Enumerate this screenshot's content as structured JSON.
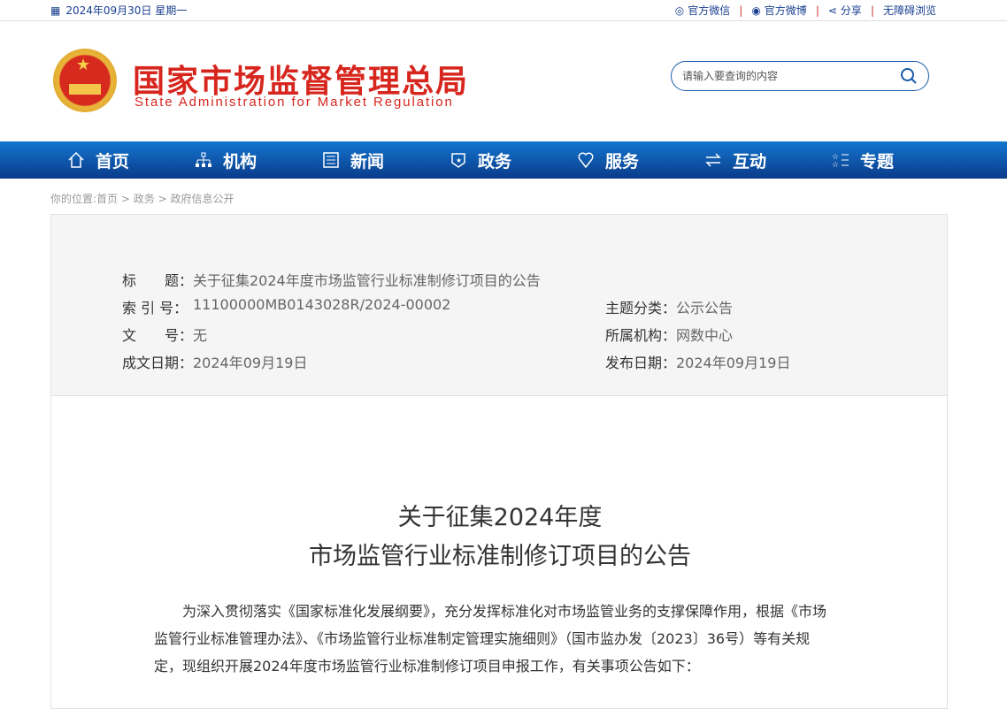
{
  "topbar": {
    "date": "2024年09月30日 星期一",
    "links": [
      "官方微信",
      "官方微博",
      "分享",
      "无障碍浏览"
    ]
  },
  "header": {
    "title": "国家市场监督管理总局",
    "subtitle": "State Administration for Market Regulation",
    "search_placeholder": "请输入要查询的内容"
  },
  "nav": [
    "首页",
    "机构",
    "新闻",
    "政务",
    "服务",
    "互动",
    "专题"
  ],
  "breadcrumb": {
    "prefix": "你的位置:",
    "items": [
      "首页",
      "政务",
      "政府信息公开"
    ],
    "sep": " > "
  },
  "meta": {
    "title_label": "标　　题：",
    "title": "关于征集2024年度市场监管行业标准制修订项目的公告",
    "index_label": "索 引 号：",
    "index": "11100000MB0143028R/2024-00002",
    "doc_label": "文　　号：",
    "doc": "无",
    "date_label": "成文日期：",
    "date": "2024年09月19日",
    "topic_label": "主题分类：",
    "topic": "公示公告",
    "org_label": "所属机构：",
    "org": "网数中心",
    "pub_label": "发布日期：",
    "pub": "2024年09月19日"
  },
  "article": {
    "title_line1": "关于征集2024年度",
    "title_line2": "市场监管行业标准制修订项目的公告",
    "para_lines": [
      "　　为深入贯彻落实《国家标准化发展纲要》，充分发挥标准化对市场监管业务的支撑保障作用，根据《市场",
      "监管行业标准管理办法》、《市场监管行业标准制定管理实施细则》（国市监办发〔2023〕36号）等有关规",
      "定，现组织开展2024年度市场监管行业标准制修订项目申报工作，有关事项公告如下："
    ]
  }
}
